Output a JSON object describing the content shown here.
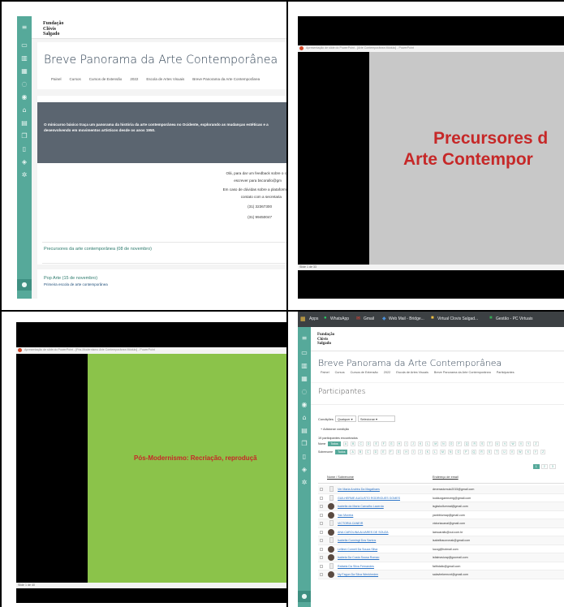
{
  "panel1": {
    "logo": [
      "Fundação",
      "Clóvis",
      "Salgado"
    ],
    "title": "Breve Panorama da Arte Contemporânea",
    "breadcrumbs": [
      "Painel",
      "Cursos",
      "Cursos de Extensão",
      "2022",
      "Escola de Artes Visuais",
      "Breve Panorama da Arte Contemporânea"
    ],
    "banner_text": "O minicurso básico traça um panorama da história da arte contemporânea no Ocidente, explorando as mudanças estéticas e a desenvolvendo em movimentos artísticos desde os anos 1950.",
    "feedback_lines": [
      "Olá, para dar um feedback sobre o c",
      "escrever para bscorallo@gm",
      "Em caso de dúvidas sobre a plataform",
      "contato com a secretaria"
    ],
    "phones": [
      "(31) 32367300",
      "(31) 99450047"
    ],
    "sections": [
      {
        "title": "Precursores da arte contemporânea (08 de novembro)",
        "sub": ""
      },
      {
        "title": "Pop Arte (15 de novembro)",
        "sub": "Primeira escola de arte contemporânea"
      }
    ]
  },
  "panel2": {
    "window_title": "Apresentação de slide do PowerPoint - [Arte Contemporânea Módulo] - PowerPoint",
    "slide_lines": [
      "Precursores d",
      "Arte Contempor"
    ],
    "status": "Slide 1 de 33"
  },
  "panel3": {
    "window_title": "Apresentação de slide do PowerPoint - [Pós-Modernismo Arte Contemporânea Módulo] - PowerPoint",
    "slide_text": "Pós-Modernismo: Recriação, reproduçã",
    "status": "Slide 1 de 40"
  },
  "panel4": {
    "bookmarks": [
      "Apps",
      "WhatsApp",
      "Gmail",
      "Web Mail - Bridge...",
      "Virtual Clovis Salgad...",
      "Gestão - PC Virtuais"
    ],
    "logo": [
      "Fundação",
      "Clóvis",
      "Salgado"
    ],
    "title": "Breve Panorama da Arte Contemporânea",
    "breadcrumbs": [
      "Painel",
      "Cursos",
      "Cursos de Extensão",
      "2022",
      "Escola de Artes Visuais",
      "Breve Panorama da Arte Contemporânea",
      "Participantes"
    ],
    "heading": "Participantes",
    "filter_label": "Condições",
    "filter_any": "Qualquer",
    "filter_select": "Selecionar",
    "add_condition": "Adicionar condição",
    "count_text": "19 participantes encontrados",
    "first_name_label": "Nome",
    "surname_label": "Sobrenome",
    "all_label": "Todos",
    "letters": [
      "A",
      "B",
      "C",
      "D",
      "E",
      "F",
      "G",
      "H",
      "I",
      "J",
      "K",
      "L",
      "M",
      "N",
      "O",
      "P",
      "Q",
      "R",
      "S",
      "T",
      "U",
      "V",
      "W",
      "X",
      "Y",
      "Z"
    ],
    "pages": [
      "1",
      "2",
      "3"
    ],
    "col_name": "Nome / Sobrenome",
    "col_email": "Endereço de email",
    "rows": [
      {
        "name": "Ver Maria Andréa Da Magalhaes",
        "email": "deverastcmulo2015@gmail.com"
      },
      {
        "name": "GUILHERME AUGUSTO RODRIGUES GOMES",
        "email": "lookluxgamezerg@gmail.com"
      },
      {
        "name": "Isabella da Maria Carvalho Lacerda",
        "email": "isgkskollurnnat@gmail.com"
      },
      {
        "name": "Yan Moreira",
        "email": "yanbblurnap@gmail.com"
      },
      {
        "name": "VICTORIA CANEIR",
        "email": "victoriacanal@gmail.com"
      },
      {
        "name": "ANA CAROLINA ALVARES DE SOUZA",
        "email": "laescaralis@oul.com.br"
      },
      {
        "name": "Isabella Cunningt Dos Santos",
        "email": "isabelbaucronak@gmail.com"
      },
      {
        "name": "Lellinni Cornell Da Souza Silva",
        "email": "lucog@hotmail.com"
      },
      {
        "name": "Isabela Da Costa Sousa Romao",
        "email": "isfalmavizap@gocmail.com"
      },
      {
        "name": "Rafaela Da Silva Fernandes",
        "email": "faithdalio@gmail.com"
      },
      {
        "name": "Ny Fagun Da Silva Wenkheden",
        "email": "salavlerkemcnt@gmail.com"
      }
    ]
  }
}
